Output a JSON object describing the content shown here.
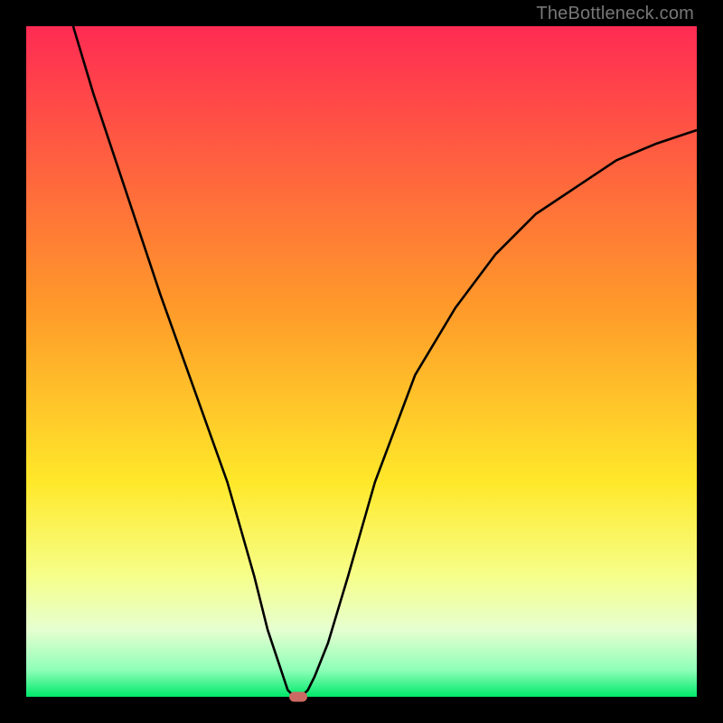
{
  "watermark": "TheBottleneck.com",
  "colors": {
    "top": "#ff2b53",
    "orange": "#ff9a2a",
    "yellow": "#ffe82a",
    "lemon": "#f6ff8a",
    "pale": "#e6ffd0",
    "mint": "#8fffb8",
    "green": "#00e86a",
    "curve": "#000000",
    "marker": "#cb6a62",
    "frameBg": "#000000"
  },
  "chart_data": {
    "type": "line",
    "title": "",
    "xlabel": "",
    "ylabel": "",
    "xlim": [
      0,
      100
    ],
    "ylim": [
      0,
      100
    ],
    "grid": false,
    "series": [
      {
        "name": "curve",
        "x": [
          7,
          10,
          15,
          20,
          25,
          30,
          34,
          36,
          38,
          39,
          40,
          41,
          42,
          43,
          45,
          48,
          52,
          58,
          64,
          70,
          76,
          82,
          88,
          94,
          100
        ],
        "y": [
          100,
          90,
          75,
          60,
          46,
          32,
          18,
          10,
          4,
          1,
          0,
          0,
          1,
          3,
          8,
          18,
          32,
          48,
          58,
          66,
          72,
          76,
          80,
          82.5,
          84.5
        ]
      }
    ],
    "marker": {
      "x": 40.5,
      "y": 0
    },
    "note": "x/y expressed as percentages of the plotting area; ylim inverted visually (0 at bottom)."
  }
}
